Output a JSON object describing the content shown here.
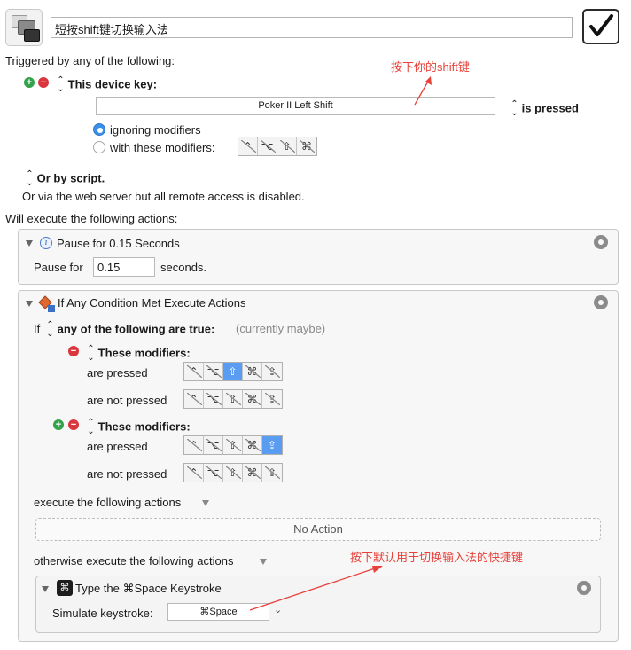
{
  "macro": {
    "name": "短按shift键切换输入法",
    "enabled": true
  },
  "trigger": {
    "header": "Triggered by any of the following:",
    "type_label": "This device key:",
    "device_key": "Poker II Left Shift",
    "state_label": "is pressed",
    "radio_ignoring": "ignoring modifiers",
    "radio_with": "with these modifiers:",
    "modifiers": [
      "⌃",
      "⌥",
      "⇧",
      "⌘"
    ],
    "script_label": "Or by script.",
    "web_note": "Or via the web server but all remote access is disabled."
  },
  "actions": {
    "header": "Will execute the following actions:",
    "pause": {
      "title": "Pause for 0.15 Seconds",
      "label_before": "Pause for",
      "value": "0.15",
      "label_after": "seconds."
    },
    "condition": {
      "title": "If Any Condition Met Execute Actions",
      "if_label": "If",
      "any_label": "any of the following are true:",
      "status": "(currently maybe)",
      "group1": {
        "title": "These modifiers:",
        "pressed_label": "are pressed",
        "not_pressed_label": "are not pressed"
      },
      "group2": {
        "title": "These modifiers:",
        "pressed_label": "are pressed",
        "not_pressed_label": "are not pressed"
      },
      "mod_keys": [
        "⌃",
        "⌥",
        "⇧",
        "⌘",
        "⇪"
      ],
      "execute_label": "execute the following actions",
      "no_action": "No Action",
      "otherwise_label": "otherwise execute the following actions",
      "keystroke": {
        "title": "Type the ⌘Space Keystroke",
        "simulate_label": "Simulate keystroke:",
        "value": "⌘Space",
        "icon_glyph": "⌘"
      }
    }
  },
  "annotations": {
    "shift_note": "按下你的shift键",
    "hotkey_note": "按下默认用于切换输入法的快捷键"
  },
  "colors": {
    "annotation": "#e8413a",
    "accent": "#3b8fe8",
    "active_modifier": "#5a9cf1"
  }
}
